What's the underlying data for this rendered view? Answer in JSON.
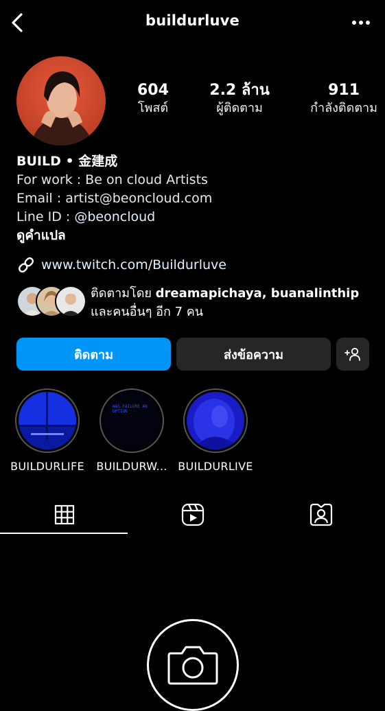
{
  "header": {
    "username": "buildurluve"
  },
  "profile": {
    "stats": [
      {
        "value": "604",
        "label": "โพสต์"
      },
      {
        "value": "2.2 ล้าน",
        "label": "ผู้ติดตาม"
      },
      {
        "value": "911",
        "label": "กำลังติดตาม"
      }
    ],
    "display_name": "BUILD • 金建成",
    "bio_lines": [
      "For work : Be on cloud Artists",
      "Email : artist@beoncloud.com"
    ],
    "line_id_label": "Line ID : ",
    "line_id_mention": "@beoncloud",
    "translate_label": "ดูคำแปล",
    "link_text": "www.twitch.com/Buildurluve",
    "followed_by_prefix": "ติดตามโดย ",
    "followed_by_names": "dreamapichaya, buanalinthip",
    "followed_by_suffix": "และคนอื่นๆ อีก 7 คน"
  },
  "actions": {
    "follow_label": "ติดตาม",
    "message_label": "ส่งข้อความ"
  },
  "highlights": [
    {
      "label": "BUILDURLIFE"
    },
    {
      "label": "BUILDURW...",
      "image_text": "WAS FAILURE AN OPTION"
    },
    {
      "label": "BUILDURLIVE"
    }
  ],
  "tabs": [
    "grid-icon",
    "reels-icon",
    "tagged-icon"
  ],
  "colors": {
    "primary_button": "#0095f6",
    "secondary_button": "#262626",
    "link": "#e0f1ff"
  }
}
